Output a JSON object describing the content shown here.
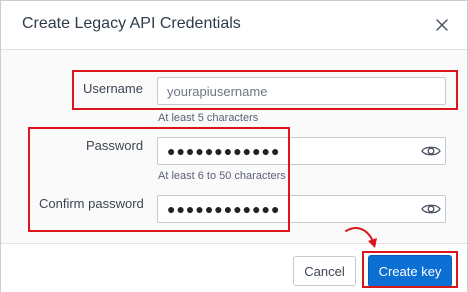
{
  "dialog": {
    "title": "Create Legacy API Credentials",
    "close_icon": "close-icon"
  },
  "form": {
    "username": {
      "label": "Username",
      "placeholder": "yourapiusername",
      "value": "",
      "hint": "At least 5 characters"
    },
    "password": {
      "label": "Password",
      "value": "●●●●●●●●●●●●",
      "hint": "At least 6 to 50 characters",
      "icon": "eye-icon"
    },
    "confirm_password": {
      "label": "Confirm password",
      "value": "●●●●●●●●●●●●",
      "icon": "eye-icon"
    }
  },
  "footer": {
    "cancel_label": "Cancel",
    "create_label": "Create key"
  },
  "annotation": {
    "highlight_color": "#d9161c",
    "icon": "curved-arrow-icon"
  },
  "colors": {
    "primary": "#0b6fd4",
    "border": "#c5cad1"
  }
}
